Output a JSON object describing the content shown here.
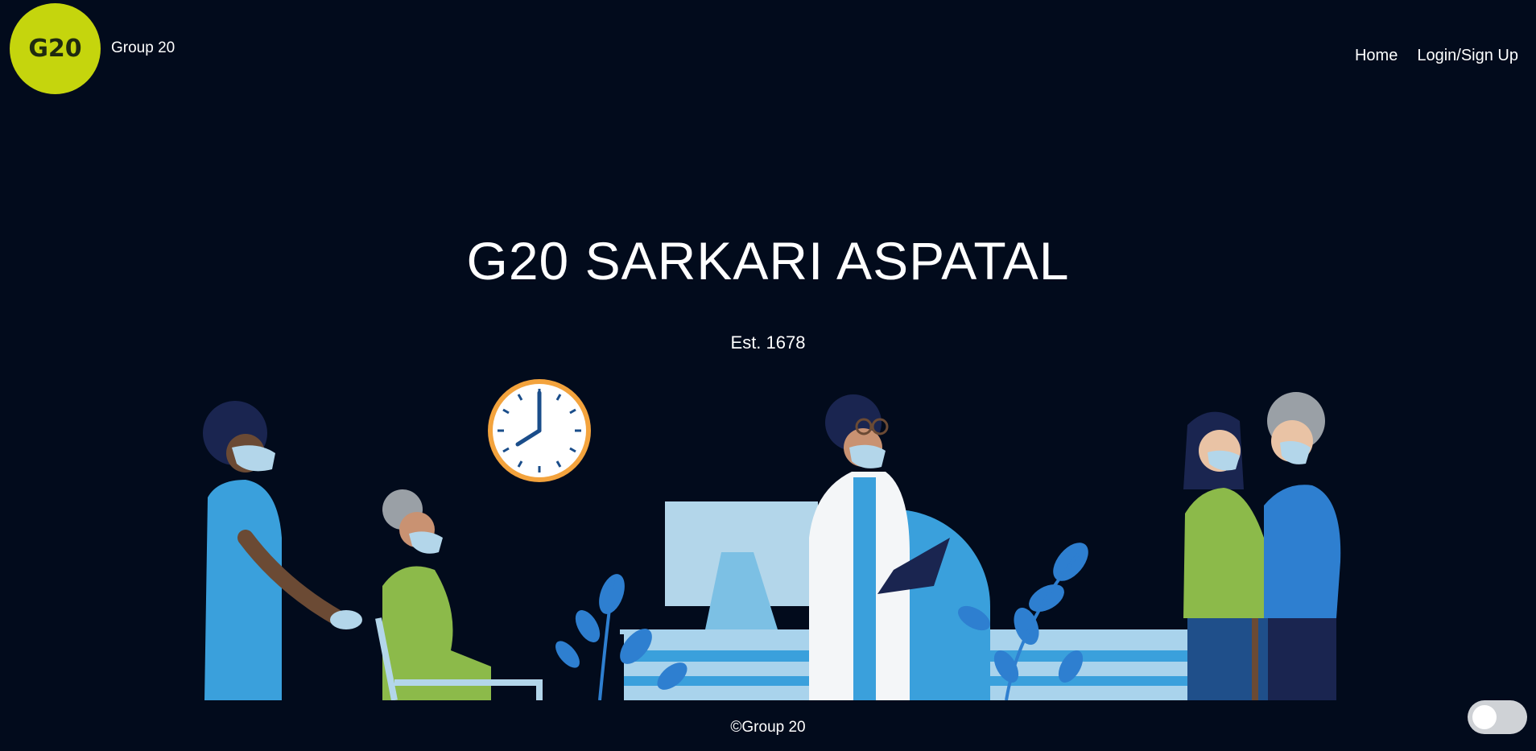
{
  "header": {
    "logo_text": "G20",
    "brand_name": "Group 20",
    "nav": [
      {
        "label": "Home"
      },
      {
        "label": "Login/Sign Up"
      }
    ]
  },
  "hero": {
    "title": "G20 SARKARI ASPATAL",
    "subtitle": "Est. 1678"
  },
  "footer": {
    "text": "©Group 20"
  },
  "theme_toggle": {
    "state": "off"
  },
  "colors": {
    "background": "#020b1c",
    "logo": "#c5d50d",
    "accent_blue": "#3aa0dc",
    "accent_green": "#8cba4a"
  }
}
